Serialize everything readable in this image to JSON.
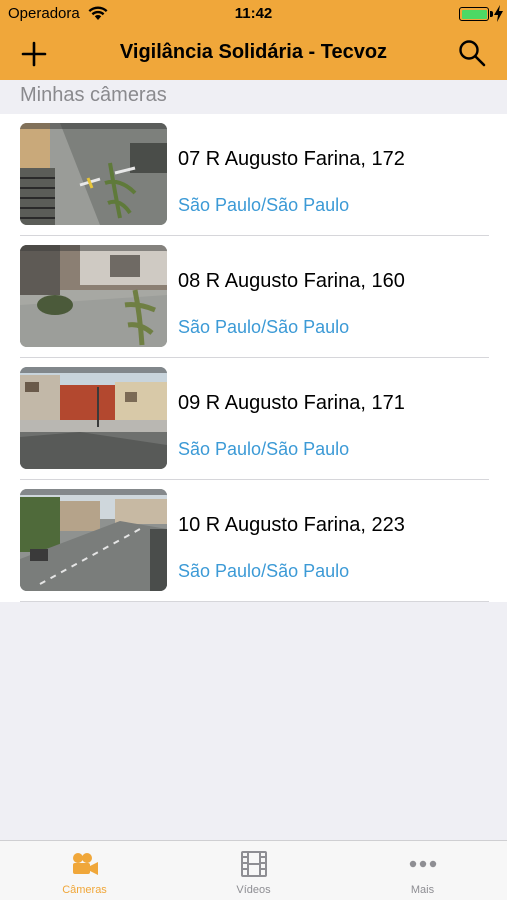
{
  "status_bar": {
    "carrier": "Operadora",
    "time": "11:42"
  },
  "nav": {
    "title": "Vigilância Solidária - Tecvoz",
    "left_icon": "plus-icon",
    "right_icon": "search-icon"
  },
  "section": {
    "title": "Minhas câmeras"
  },
  "cameras": [
    {
      "name": "07 R Augusto Farina, 172",
      "location": "São Paulo/São Paulo"
    },
    {
      "name": "08 R Augusto Farina, 160",
      "location": "São Paulo/São Paulo"
    },
    {
      "name": "09 R Augusto Farina, 171",
      "location": "São Paulo/São Paulo"
    },
    {
      "name": "10 R Augusto Farina, 223",
      "location": "São Paulo/São Paulo"
    }
  ],
  "tabs": [
    {
      "label": "Câmeras",
      "icon": "video-camera-icon",
      "active": true
    },
    {
      "label": "Vídeos",
      "icon": "film-icon",
      "active": false
    },
    {
      "label": "Mais",
      "icon": "more-icon",
      "active": false
    }
  ],
  "colors": {
    "accent": "#f0a73a",
    "link": "#3c9ad6",
    "background": "#efeff4"
  }
}
